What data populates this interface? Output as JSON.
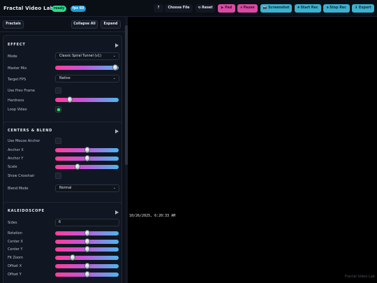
{
  "header": {
    "app_title": "Fractal Video Lab",
    "status_badge": "ready",
    "fps_badge": "fps 60",
    "help_label": "?",
    "choose_file_label": "Choose File",
    "reset_label": "⟲ Reset",
    "pad_label": "▶ Pad",
    "pause_label": "⏸ Pause",
    "screenshot_label": "📷 Screenshot",
    "start_rec_label": "⏺ Start Rec",
    "stop_rec_label": "⏹ Stop Rec",
    "export_label": "⬇ Export"
  },
  "sidebar": {
    "fractals_label": "Fractals",
    "collapse_all_label": "Collapse All",
    "expand_label": "Expand",
    "effect": {
      "title": "EFFECT",
      "mode_label": "Mode",
      "mode_value": "Classic Spiral Tunnel (v1)",
      "master_mix_label": "Master Mix",
      "master_mix_value": 0.95,
      "target_fps_label": "Target FPS",
      "target_fps_value": "Native",
      "use_prev_frame_label": "Use Prev Frame",
      "use_prev_frame_checked": false,
      "hardness_label": "Hardness",
      "hardness_value": 0.23,
      "loop_video_label": "Loop Video",
      "loop_video_checked": true
    },
    "centers_blend": {
      "title": "CENTERS & BLEND",
      "use_mouse_anchor_label": "Use Mouse Anchor",
      "use_mouse_anchor_checked": false,
      "anchor_x_label": "Anchor X",
      "anchor_x_value": 0.5,
      "anchor_y_label": "Anchor Y",
      "anchor_y_value": 0.5,
      "scale_label": "Scale",
      "scale_value": 0.35,
      "show_crosshair_label": "Show Crosshair",
      "show_crosshair_checked": false,
      "blend_mode_label": "Blend Mode",
      "blend_mode_value": "Normal"
    },
    "kaleidoscope": {
      "title": "KALEIDOSCOPE",
      "sides_label": "Sides",
      "sides_value": "6",
      "rotation_label": "Rotation",
      "rotation_value": 0.5,
      "center_x_label": "Center X",
      "center_x_value": 0.5,
      "center_y_label": "Center Y",
      "center_y_value": 0.5,
      "fit_zoom_label": "Fit Zoom",
      "fit_zoom_value": 0.28,
      "offset_x_label": "Offset X",
      "offset_x_value": 0.5,
      "offset_y_label": "Offset Y",
      "offset_y_value": 0.5
    }
  },
  "canvas": {
    "timestamp": "10/26/2025, 6:20:33 AM",
    "watermark": "Fractal Video Lab"
  }
}
